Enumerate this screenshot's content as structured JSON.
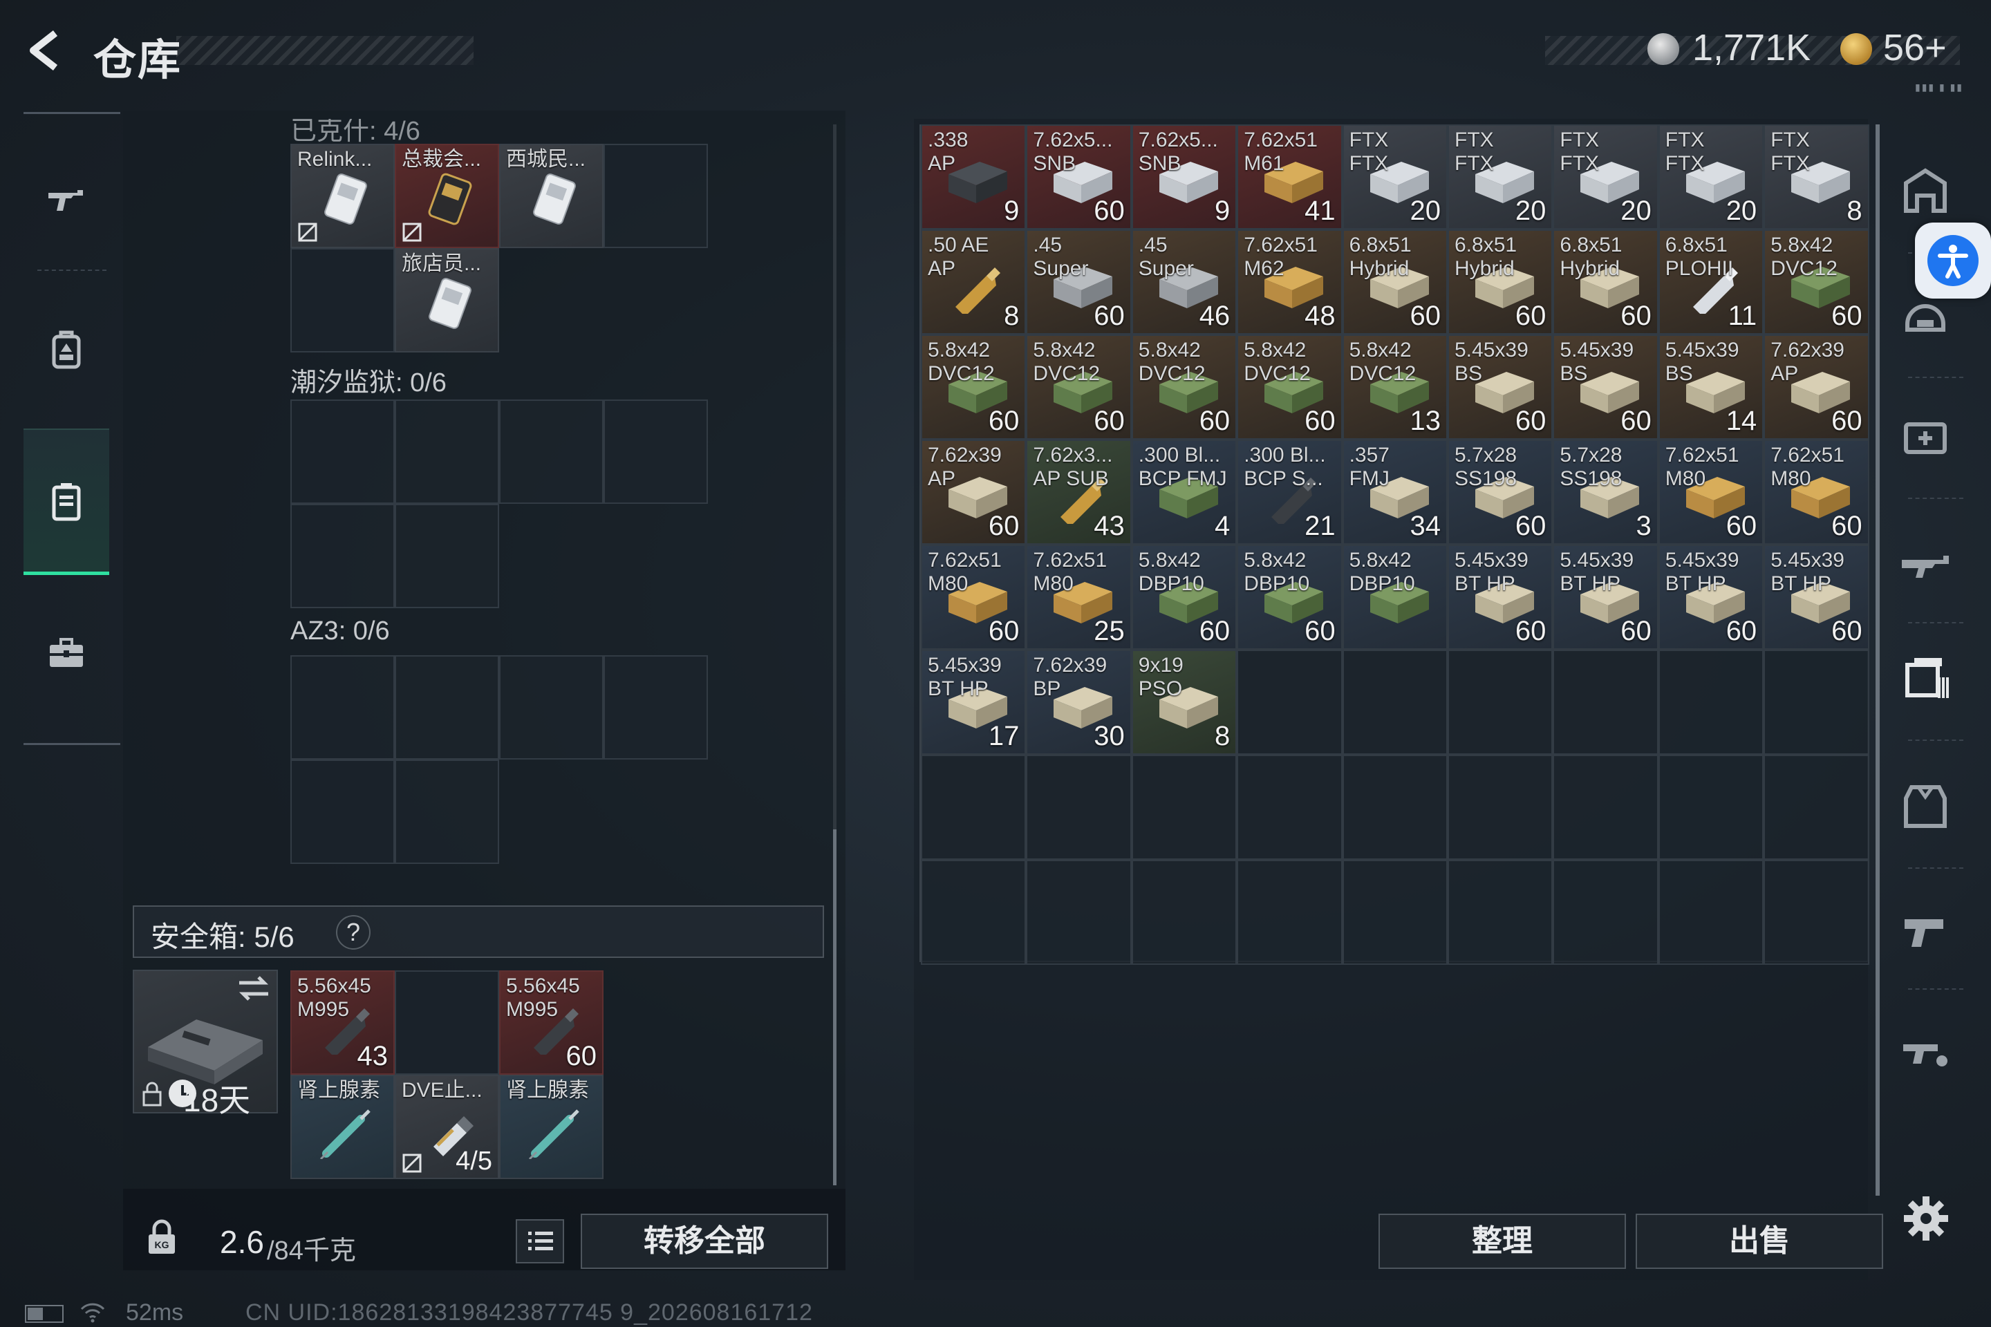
{
  "header": {
    "title": "仓库",
    "coin_value": "1,771K",
    "gold_value": "56+",
    "deco_text": "▮▮▮ ▮ ▮▮"
  },
  "left_nav": {
    "items": [
      "weapon-icon",
      "backpack-gear-icon",
      "backpack-icon",
      "toolbox-icon"
    ],
    "active": "backpack-icon"
  },
  "containers": {
    "cut_label": "已克什: 4/6",
    "section1_items": [
      {
        "name": "Relink...",
        "art": "keycard",
        "no_entry": true,
        "red": false
      },
      {
        "name": "总裁会...",
        "art": "keycard-gold",
        "no_entry": true,
        "red": true
      },
      {
        "name": "西城民...",
        "art": "keycard",
        "no_entry": false,
        "red": false
      },
      {
        "name": "旅店员...",
        "art": "keycard",
        "no_entry": false,
        "red": false
      }
    ],
    "tide_prison_label": "潮汐监狱: 0/6",
    "az3_label": "AZ3: 0/6"
  },
  "safe_box": {
    "label": "安全箱:  5/6",
    "help": "?",
    "days": "18天",
    "items": [
      {
        "name": "5.56x45\nM995",
        "count": "43"
      },
      {
        "name": "5.56x45\nM995",
        "count": "60"
      },
      {
        "name": "肾上腺素",
        "count": ""
      },
      {
        "name": "DVE止...",
        "count": "",
        "uses": "4/5"
      },
      {
        "name": "肾上腺素",
        "count": ""
      }
    ]
  },
  "footer": {
    "weight_current": "2.6",
    "weight_max": "/84千克",
    "transfer_all": "转移全部",
    "sort": "整理",
    "sell": "出售"
  },
  "status": {
    "ping": "52ms",
    "uid": "CN UID:18628133198423877745 9_202608161712"
  },
  "stash": {
    "items": [
      {
        "name": ".338\nAP",
        "count": "9",
        "art": "dark-box",
        "bg": "red"
      },
      {
        "name": "7.62x5...\nSNB",
        "count": "60",
        "art": "white-box",
        "bg": "red"
      },
      {
        "name": "7.62x5...\nSNB",
        "count": "9",
        "art": "white-box",
        "bg": "red"
      },
      {
        "name": "7.62x51\nM61",
        "count": "41",
        "art": "gold-box",
        "bg": "red"
      },
      {
        "name": "FTX\nFTX",
        "count": "20",
        "art": "white-box",
        "bg": "gray"
      },
      {
        "name": "FTX\nFTX",
        "count": "20",
        "art": "white-box",
        "bg": "gray"
      },
      {
        "name": "FTX\nFTX",
        "count": "20",
        "art": "white-box",
        "bg": "gray"
      },
      {
        "name": "FTX\nFTX",
        "count": "20",
        "art": "white-box",
        "bg": "gray"
      },
      {
        "name": "FTX\nFTX",
        "count": "8",
        "art": "white-box",
        "bg": "gray"
      },
      {
        "name": ".50 AE\nAP",
        "count": "8",
        "art": "bullet-gold",
        "bg": "brown"
      },
      {
        "name": ".45\nSuper",
        "count": "60",
        "art": "gray-box",
        "bg": "brown"
      },
      {
        "name": ".45\nSuper",
        "count": "46",
        "art": "gray-box",
        "bg": "brown"
      },
      {
        "name": "7.62x51\nM62",
        "count": "48",
        "art": "gold-box",
        "bg": "brown"
      },
      {
        "name": "6.8x51\nHybrid",
        "count": "60",
        "art": "tan-box",
        "bg": "brown"
      },
      {
        "name": "6.8x51\nHybrid",
        "count": "60",
        "art": "tan-box",
        "bg": "brown"
      },
      {
        "name": "6.8x51\nHybrid",
        "count": "60",
        "art": "tan-box",
        "bg": "brown"
      },
      {
        "name": "6.8x51\nPLOHII",
        "count": "11",
        "art": "bullet-silver",
        "bg": "brown"
      },
      {
        "name": "5.8x42\nDVC12",
        "count": "60",
        "art": "green-box",
        "bg": "brown"
      },
      {
        "name": "5.8x42\nDVC12",
        "count": "60",
        "art": "green-box",
        "bg": "brown"
      },
      {
        "name": "5.8x42\nDVC12",
        "count": "60",
        "art": "green-box",
        "bg": "brown"
      },
      {
        "name": "5.8x42\nDVC12",
        "count": "60",
        "art": "green-box",
        "bg": "brown"
      },
      {
        "name": "5.8x42\nDVC12",
        "count": "60",
        "art": "green-box",
        "bg": "brown"
      },
      {
        "name": "5.8x42\nDVC12",
        "count": "13",
        "art": "green-box",
        "bg": "brown"
      },
      {
        "name": "5.45x39\nBS",
        "count": "60",
        "art": "tan-box",
        "bg": "brown"
      },
      {
        "name": "5.45x39\nBS",
        "count": "60",
        "art": "tan-box",
        "bg": "brown"
      },
      {
        "name": "5.45x39\nBS",
        "count": "14",
        "art": "tan-box",
        "bg": "brown"
      },
      {
        "name": "7.62x39\nAP",
        "count": "60",
        "art": "tan-box",
        "bg": "brown"
      },
      {
        "name": "7.62x39\nAP",
        "count": "60",
        "art": "tan-box",
        "bg": "brown"
      },
      {
        "name": "7.62x3...\nAP SUB",
        "count": "43",
        "art": "bullet-gold",
        "bg": "green"
      },
      {
        "name": ".300 Bl...\nBCP FMJ",
        "count": "4",
        "art": "green-box",
        "bg": "blue"
      },
      {
        "name": ".300 Bl...\nBCP S...",
        "count": "21",
        "art": "bullet-dark",
        "bg": "blue"
      },
      {
        "name": ".357\nFMJ",
        "count": "34",
        "art": "tan-box",
        "bg": "blue"
      },
      {
        "name": "5.7x28\nSS198",
        "count": "60",
        "art": "tan-box",
        "bg": "blue"
      },
      {
        "name": "5.7x28\nSS198",
        "count": "3",
        "art": "tan-box",
        "bg": "blue"
      },
      {
        "name": "7.62x51\nM80",
        "count": "60",
        "art": "gold-box",
        "bg": "blue"
      },
      {
        "name": "7.62x51\nM80",
        "count": "60",
        "art": "gold-box",
        "bg": "blue"
      },
      {
        "name": "7.62x51\nM80",
        "count": "60",
        "art": "gold-box",
        "bg": "blue"
      },
      {
        "name": "7.62x51\nM80",
        "count": "25",
        "art": "gold-box",
        "bg": "blue"
      },
      {
        "name": "5.8x42\nDBP10",
        "count": "60",
        "art": "green-box",
        "bg": "blue"
      },
      {
        "name": "5.8x42\nDBP10",
        "count": "60",
        "art": "green-box",
        "bg": "blue"
      },
      {
        "name": "5.8x42\nDBP10",
        "count": "",
        "art": "green-box",
        "bg": "blue"
      },
      {
        "name": "5.45x39\nBT HP",
        "count": "60",
        "art": "tan-box",
        "bg": "blue"
      },
      {
        "name": "5.45x39\nBT HP",
        "count": "60",
        "art": "tan-box",
        "bg": "blue"
      },
      {
        "name": "5.45x39\nBT HP",
        "count": "60",
        "art": "tan-box",
        "bg": "blue"
      },
      {
        "name": "5.45x39\nBT HP",
        "count": "60",
        "art": "tan-box",
        "bg": "blue"
      },
      {
        "name": "5.45x39\nBT HP",
        "count": "17",
        "art": "tan-box",
        "bg": "blue"
      },
      {
        "name": "7.62x39\nBP",
        "count": "30",
        "art": "tan-box",
        "bg": "blue"
      },
      {
        "name": "9x19\nPSO",
        "count": "8",
        "art": "tan-box",
        "bg": "green"
      }
    ]
  },
  "right_nav": {
    "items": [
      "safehouse-icon",
      "helmet-icon",
      "medkit-icon",
      "rifle-icon",
      "ammo-icon",
      "armor-icon",
      "pistol-icon",
      "gun-parts-icon"
    ],
    "active": "ammo-icon"
  },
  "colors": {
    "bg_red": "#5a2b2b",
    "bg_brown": "#3f362d",
    "bg_blue": "#2a3340",
    "bg_gray": "#373c44",
    "bg_green": "#2f3b32",
    "accent": "#2fe0a0",
    "access_blue": "#1f76f0"
  }
}
